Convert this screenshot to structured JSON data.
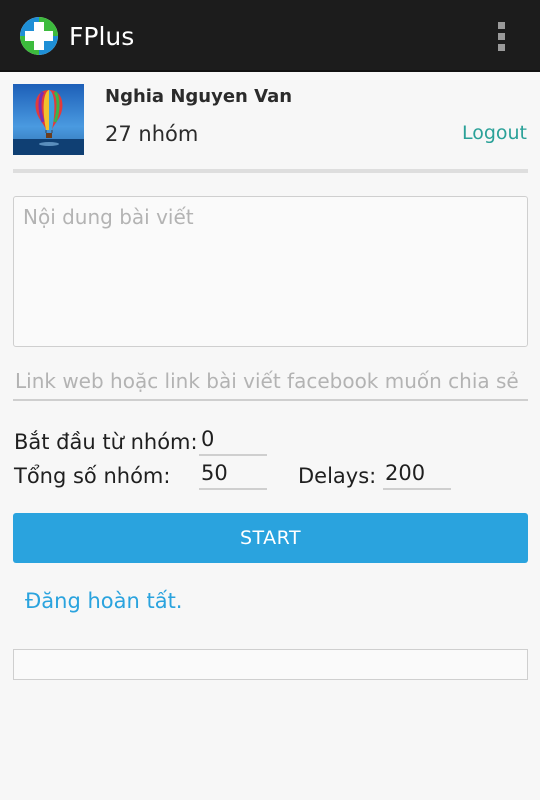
{
  "app": {
    "title": "FPlus",
    "logo_icon": "green-cross-logo-icon",
    "menu_icon": "overflow-menu-icon"
  },
  "user": {
    "name": "Nghia Nguyen Van",
    "group_count_text": "27 nhóm",
    "logout_label": "Logout",
    "avatar_image": "hot-air-balloon"
  },
  "form": {
    "content_placeholder": "Nội dung bài viết",
    "link_placeholder": "Link web hoặc link bài viết facebook muốn chia sẻ",
    "start_group_label": "Bắt đầu từ nhóm:",
    "start_group_value": "0",
    "total_groups_label": "Tổng số nhóm:",
    "total_groups_value": "50",
    "delays_label": "Delays:",
    "delays_value": "200",
    "start_button_label": "START"
  },
  "status": {
    "message": "Đăng hoàn tất.",
    "progress": 0
  },
  "colors": {
    "accent": "#2aa3de",
    "logout": "#2aa198",
    "actionbar": "#1c1c1c",
    "logo_green": "#3dbb3d",
    "logo_blue": "#1e8fd6"
  }
}
